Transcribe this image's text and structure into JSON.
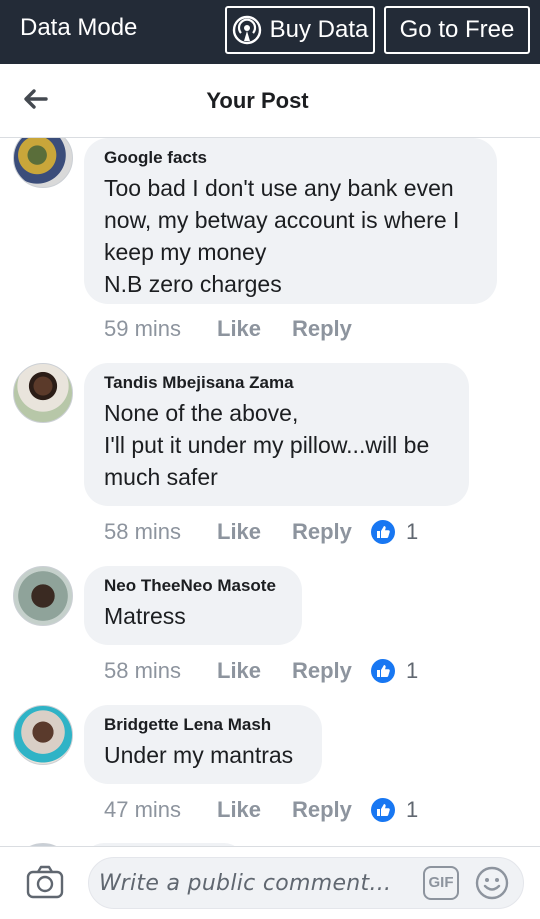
{
  "data_mode": {
    "title": "Data Mode",
    "buy_data_label": "Buy Data",
    "buy_data_icon": "signal-broadcast-icon",
    "go_free_label": "Go to Free"
  },
  "header": {
    "back_icon": "back-arrow-icon",
    "title": "Your Post"
  },
  "comments": [
    {
      "author": "Google facts",
      "text": "Too bad I don't use any bank even\nnow, my betway account is where I\nkeep my money\nN.B zero charges",
      "time": "59 mins",
      "like": "Like",
      "reply": "Reply",
      "reactions": null
    },
    {
      "author": "Tandis Mbejisana Zama",
      "text": "None of the above,\nI'll put it under my pillow...will be\nmuch safer",
      "time": "58 mins",
      "like": "Like",
      "reply": "Reply",
      "reactions": "1"
    },
    {
      "author": "Neo TheeNeo Masote",
      "text": "Matress",
      "time": "58 mins",
      "like": "Like",
      "reply": "Reply",
      "reactions": "1"
    },
    {
      "author": "Bridgette Lena Mash",
      "text": "Under my mantras",
      "time": "47 mins",
      "like": "Like",
      "reply": "Reply",
      "reactions": "1"
    }
  ],
  "composer": {
    "camera_icon": "camera-icon",
    "placeholder": "Write a public comment...",
    "gif_label": "GIF",
    "emoji_icon": "emoji-smile-icon"
  },
  "colors": {
    "top_bar": "#232b37",
    "bubble": "#f0f2f5",
    "like_reaction": "#1877f2",
    "meta_text": "#8d949e"
  }
}
